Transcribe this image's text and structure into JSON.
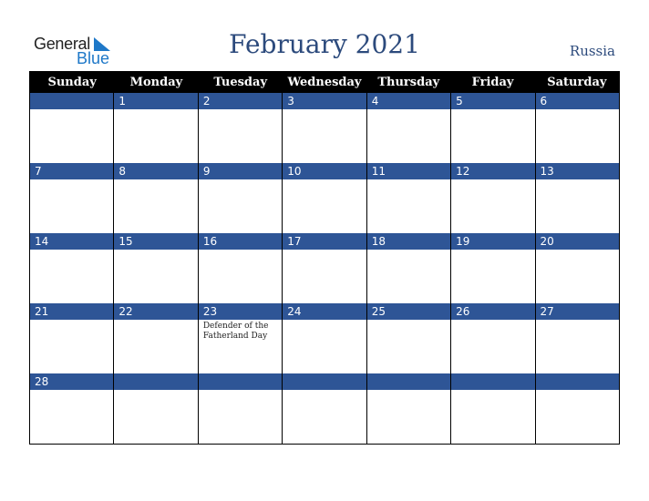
{
  "logo": {
    "general": "General",
    "blue": "Blue"
  },
  "title": "February 2021",
  "country": "Russia",
  "weekdays": [
    "Sunday",
    "Monday",
    "Tuesday",
    "Wednesday",
    "Thursday",
    "Friday",
    "Saturday"
  ],
  "weeks": [
    [
      {
        "d": ""
      },
      {
        "d": "1"
      },
      {
        "d": "2"
      },
      {
        "d": "3"
      },
      {
        "d": "4"
      },
      {
        "d": "5"
      },
      {
        "d": "6"
      }
    ],
    [
      {
        "d": "7"
      },
      {
        "d": "8"
      },
      {
        "d": "9"
      },
      {
        "d": "10"
      },
      {
        "d": "11"
      },
      {
        "d": "12"
      },
      {
        "d": "13"
      }
    ],
    [
      {
        "d": "14"
      },
      {
        "d": "15"
      },
      {
        "d": "16"
      },
      {
        "d": "17"
      },
      {
        "d": "18"
      },
      {
        "d": "19"
      },
      {
        "d": "20"
      }
    ],
    [
      {
        "d": "21"
      },
      {
        "d": "22"
      },
      {
        "d": "23",
        "event": "Defender of the Fatherland Day"
      },
      {
        "d": "24"
      },
      {
        "d": "25"
      },
      {
        "d": "26"
      },
      {
        "d": "27"
      }
    ],
    [
      {
        "d": "28"
      },
      {
        "d": ""
      },
      {
        "d": ""
      },
      {
        "d": ""
      },
      {
        "d": ""
      },
      {
        "d": ""
      },
      {
        "d": ""
      }
    ]
  ]
}
